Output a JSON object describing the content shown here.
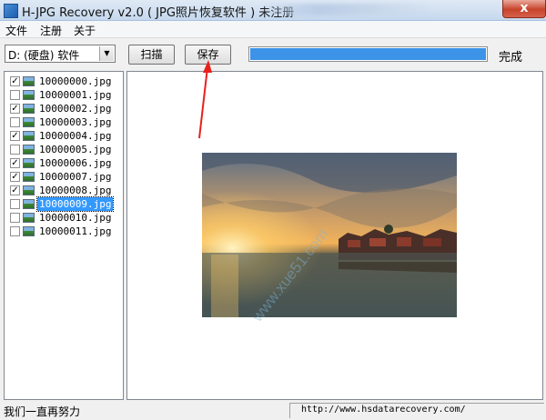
{
  "window": {
    "title": "H-JPG Recovery v2.0 ( JPG照片恢复软件 ) 未注册",
    "close_symbol": "x",
    "icon": "app-icon"
  },
  "menu": [
    "文件",
    "注册",
    "关于"
  ],
  "toolbar": {
    "drive_value": "D: (硬盘) 软件",
    "drive_arrow": "▼",
    "scan_label": "扫描",
    "save_label": "保存",
    "progress": 1.0,
    "status": "完成"
  },
  "files": [
    {
      "name": "10000000.jpg",
      "checked": true
    },
    {
      "name": "10000001.jpg",
      "checked": false
    },
    {
      "name": "10000002.jpg",
      "checked": true
    },
    {
      "name": "10000003.jpg",
      "checked": false
    },
    {
      "name": "10000004.jpg",
      "checked": true
    },
    {
      "name": "10000005.jpg",
      "checked": false
    },
    {
      "name": "10000006.jpg",
      "checked": true
    },
    {
      "name": "10000007.jpg",
      "checked": true
    },
    {
      "name": "10000008.jpg",
      "checked": true
    },
    {
      "name": "10000009.jpg",
      "checked": false,
      "selected": true
    },
    {
      "name": "10000010.jpg",
      "checked": false
    },
    {
      "name": "10000011.jpg",
      "checked": false
    }
  ],
  "statusbar": {
    "left": "我们一直再努力",
    "url": "http://www.hsdatarecovery.com/"
  },
  "watermark": {
    "text": "www.xue51.com",
    "brand": "xue51-watermark"
  },
  "colors": {
    "progress": "#3c93e8",
    "selection": "#3399ff",
    "annotation_arrow": "#e8201c"
  }
}
